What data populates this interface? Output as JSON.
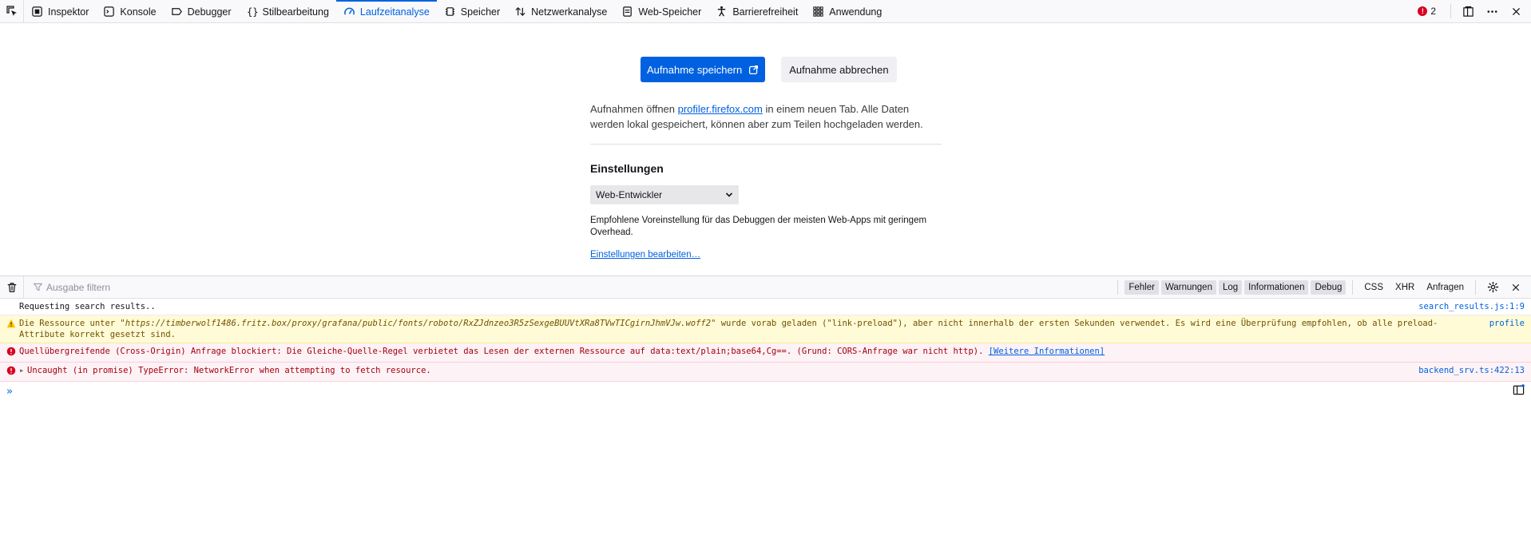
{
  "toolbar": {
    "tabs": [
      {
        "label": "Inspektor",
        "icon": "inspector-icon"
      },
      {
        "label": "Konsole",
        "icon": "console-icon"
      },
      {
        "label": "Debugger",
        "icon": "debugger-icon"
      },
      {
        "label": "Stilbearbeitung",
        "icon": "style-editor-icon"
      },
      {
        "label": "Laufzeitanalyse",
        "icon": "performance-icon"
      },
      {
        "label": "Speicher",
        "icon": "memory-icon"
      },
      {
        "label": "Netzwerkanalyse",
        "icon": "network-icon"
      },
      {
        "label": "Web-Speicher",
        "icon": "storage-icon"
      },
      {
        "label": "Barrierefreiheit",
        "icon": "accessibility-icon"
      },
      {
        "label": "Anwendung",
        "icon": "application-icon"
      }
    ],
    "active_tab": "Laufzeitanalyse",
    "error_count": "2"
  },
  "profiler": {
    "save_button": "Aufnahme speichern",
    "cancel_button": "Aufnahme abbrechen",
    "desc_prefix": "Aufnahmen öffnen ",
    "desc_link": "profiler.firefox.com",
    "desc_suffix": " in einem neuen Tab. Alle Daten werden lokal gespeichert, können aber zum Teilen hochgeladen werden.",
    "settings_title": "Einstellungen",
    "preset_value": "Web-Entwickler",
    "preset_description": "Empfohlene Voreinstellung für das Debuggen der meisten Web-Apps mit geringem Overhead.",
    "edit_settings_link": "Einstellungen bearbeiten…"
  },
  "console": {
    "filter_placeholder": "Ausgabe filtern",
    "level_filters": [
      "Fehler",
      "Warnungen",
      "Log",
      "Informationen",
      "Debug"
    ],
    "type_filters": [
      "CSS",
      "XHR",
      "Anfragen"
    ],
    "messages": [
      {
        "type": "log",
        "text": "Requesting search results..",
        "source": "search_results.js:1:9"
      },
      {
        "type": "warn",
        "text_prefix": "Die Ressource unter \"",
        "text_url": "https://timberwolf1486.fritz.box/proxy/grafana/public/fonts/roboto/RxZJdnzeo3R5zSexgeBUUVtXRa8TVwTICgirnJhmVJw.woff2",
        "text_suffix": "\" wurde vorab geladen (\"link-preload\"), aber nicht innerhalb der ersten Sekunden verwendet. Es wird eine Überprüfung empfohlen, ob alle preload-Attribute korrekt gesetzt sind.",
        "source": "profile"
      },
      {
        "type": "error",
        "text": "Quellübergreifende (Cross-Origin) Anfrage blockiert: Die Gleiche-Quelle-Regel verbietet das Lesen der externen Ressource auf data:text/plain;base64,Cg==. (Grund: CORS-Anfrage war nicht http). ",
        "link": "[Weitere Informationen]"
      },
      {
        "type": "error",
        "text": "Uncaught (in promise) TypeError: NetworkError when attempting to fetch resource.",
        "source": "backend_srv.ts:422:13"
      }
    ],
    "prompt": "»"
  },
  "colors": {
    "accent": "#0061e0",
    "error": "#d70022",
    "warning": "#ffbf00"
  }
}
